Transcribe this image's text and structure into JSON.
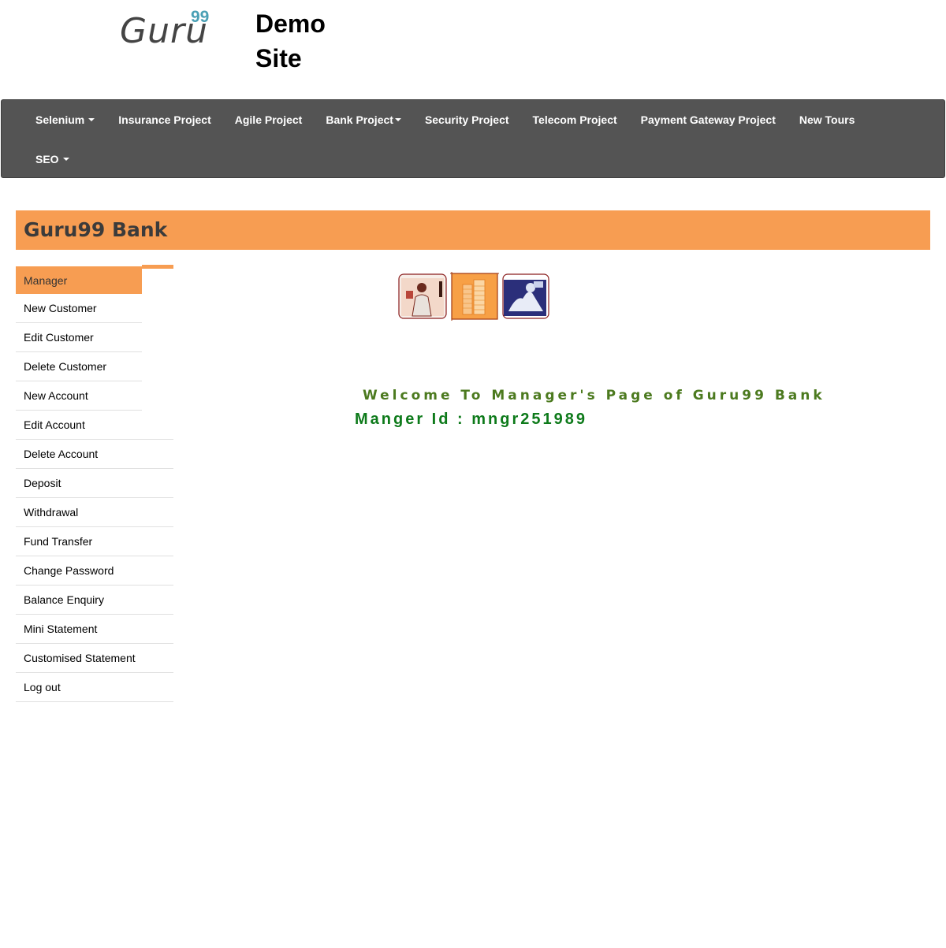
{
  "header": {
    "logo_text": "Guru",
    "logo_sup": "99",
    "site_title": "Demo Site"
  },
  "nav": {
    "row1": [
      {
        "label": "Selenium",
        "dropdown": true
      },
      {
        "label": "Insurance Project",
        "dropdown": false
      },
      {
        "label": "Agile Project",
        "dropdown": false
      },
      {
        "label": "Bank Project",
        "dropdown": true
      },
      {
        "label": "Security Project",
        "dropdown": false
      },
      {
        "label": "Telecom Project",
        "dropdown": false
      },
      {
        "label": "Payment Gateway Project",
        "dropdown": false
      },
      {
        "label": "New Tours",
        "dropdown": false
      }
    ],
    "row2": [
      {
        "label": "SEO",
        "dropdown": true
      }
    ]
  },
  "bank": {
    "title": "Guru99 Bank"
  },
  "sidebar": {
    "items": [
      {
        "label": "Manager",
        "active": true
      },
      {
        "label": "New Customer"
      },
      {
        "label": "Edit Customer"
      },
      {
        "label": "Delete Customer"
      },
      {
        "label": "New Account"
      },
      {
        "label": "Edit Account"
      },
      {
        "label": "Delete Account"
      },
      {
        "label": "Deposit"
      },
      {
        "label": "Withdrawal"
      },
      {
        "label": "Fund Transfer"
      },
      {
        "label": "Change Password"
      },
      {
        "label": "Balance Enquiry"
      },
      {
        "label": "Mini Statement"
      },
      {
        "label": "Customised Statement"
      },
      {
        "label": "Log out"
      }
    ]
  },
  "main": {
    "welcome": "Welcome To Manager's Page of Guru99 Bank",
    "manager_id": "Manger Id : mngr251989"
  },
  "colors": {
    "navbar_bg": "#545454",
    "accent_orange": "#f79d52",
    "welcome_green": "#4c7a1f",
    "manager_id_green": "#0d7a1a"
  }
}
